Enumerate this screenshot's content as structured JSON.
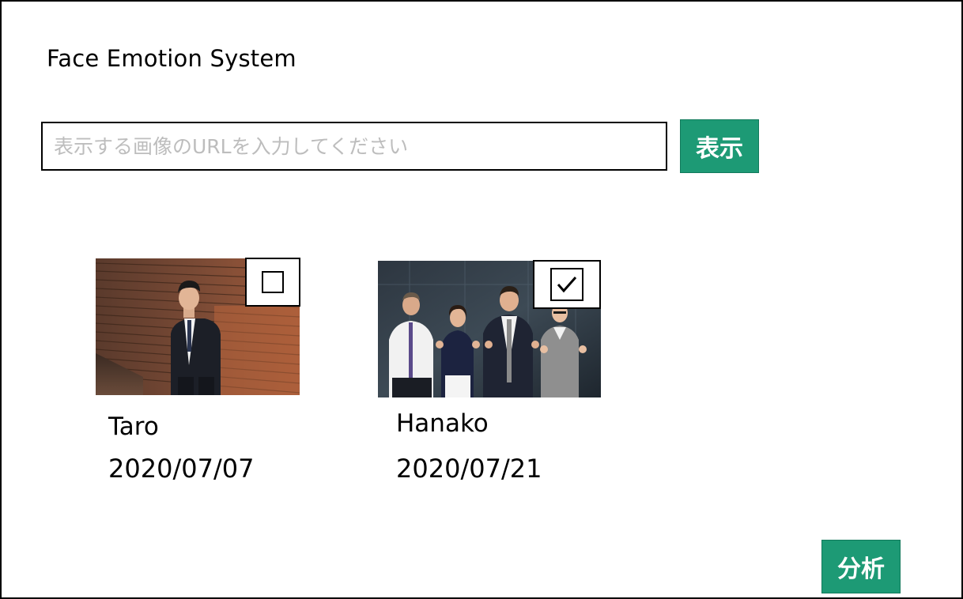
{
  "app": {
    "title": "Face Emotion System"
  },
  "search": {
    "placeholder": "表示する画像のURLを入力してください",
    "value": "",
    "button_label": "表示"
  },
  "photos": [
    {
      "name": "Taro",
      "date": "2020/07/07",
      "checked": false,
      "image": "man-in-suit-photo"
    },
    {
      "name": "Hanako",
      "date": "2020/07/21",
      "checked": true,
      "image": "business-team-thumbs-up-photo"
    }
  ],
  "actions": {
    "analyze_label": "分析"
  },
  "colors": {
    "accent": "#1d9a75",
    "border": "#000000",
    "placeholder": "#bdbdbd"
  }
}
